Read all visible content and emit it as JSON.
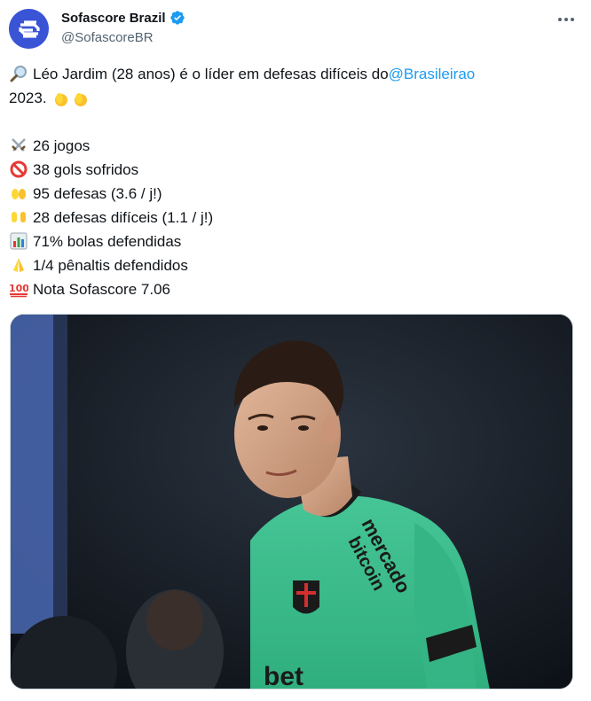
{
  "author": {
    "display_name": "Sofascore Brazil",
    "handle": "@SofascoreBR",
    "verified": true
  },
  "tweet": {
    "intro_before": "Léo Jardim (28 anos) é o líder em defesas difíceis do ",
    "mention": "@Brasileirao",
    "intro_after": "2023.",
    "stats": [
      {
        "icon": "crossed-swords-icon",
        "text": "26 jogos"
      },
      {
        "icon": "prohibited-icon",
        "text": "38 gols sofridos"
      },
      {
        "icon": "open-hands-icon",
        "text": "95 defesas (3.6 / j!)"
      },
      {
        "icon": "raising-hands-icon",
        "text": "28 defesas difíceis (1.1 / j!)"
      },
      {
        "icon": "bar-chart-icon",
        "text": "71% bolas defendidas"
      },
      {
        "icon": "folded-hands-icon",
        "text": "1/4 pênaltis defendidos"
      },
      {
        "icon": "hundred-points-icon",
        "text": "Nota Sofascore 7.06"
      }
    ]
  },
  "media": {
    "jersey_sponsor": "Mercado Bitcoin",
    "jersey_color": "#3bbf8e"
  },
  "colors": {
    "link": "#1d9bf0",
    "brand": "#3a54d6",
    "verified": "#1d9bf0"
  }
}
